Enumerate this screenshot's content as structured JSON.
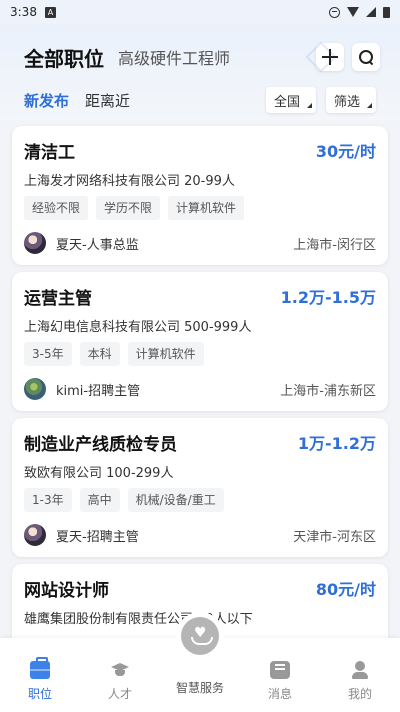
{
  "status_bar": {
    "time": "3:38",
    "notif_badge": "A"
  },
  "header": {
    "tab_main": "全部职位",
    "tab_sub": "高级硬件工程师"
  },
  "filters": {
    "tabs": [
      "新发布",
      "距离近"
    ],
    "region": "全国",
    "filter": "筛选"
  },
  "jobs": [
    {
      "title": "清洁工",
      "salary": "30元/时",
      "company": "上海发才网络科技有限公司 20-99人",
      "tags": [
        "经验不限",
        "学历不限",
        "计算机软件"
      ],
      "recruiter": "夏天-人事总监",
      "location": "上海市-闵行区"
    },
    {
      "title": "运营主管",
      "salary": "1.2万-1.5万",
      "company": "上海幻电信息科技有限公司 500-999人",
      "tags": [
        "3-5年",
        "本科",
        "计算机软件"
      ],
      "recruiter": "kimi-招聘主管",
      "location": "上海市-浦东新区"
    },
    {
      "title": "制造业产线质检专员",
      "salary": "1万-1.2万",
      "company": "致欧有限公司 100-299人",
      "tags": [
        "1-3年",
        "高中",
        "机械/设备/重工"
      ],
      "recruiter": "夏天-招聘主管",
      "location": "天津市-河东区"
    },
    {
      "title": "网站设计师",
      "salary": "80元/时",
      "company": "雄鹰集团股份制有限责任公司 20人以下",
      "tags": [],
      "recruiter": "",
      "location": ""
    }
  ],
  "bottom_nav": {
    "items": [
      "职位",
      "人才",
      "智慧服务",
      "消息",
      "我的"
    ],
    "active": "职位"
  },
  "colors": {
    "accent": "#2e6fd8",
    "background": "#f2f4f7"
  }
}
